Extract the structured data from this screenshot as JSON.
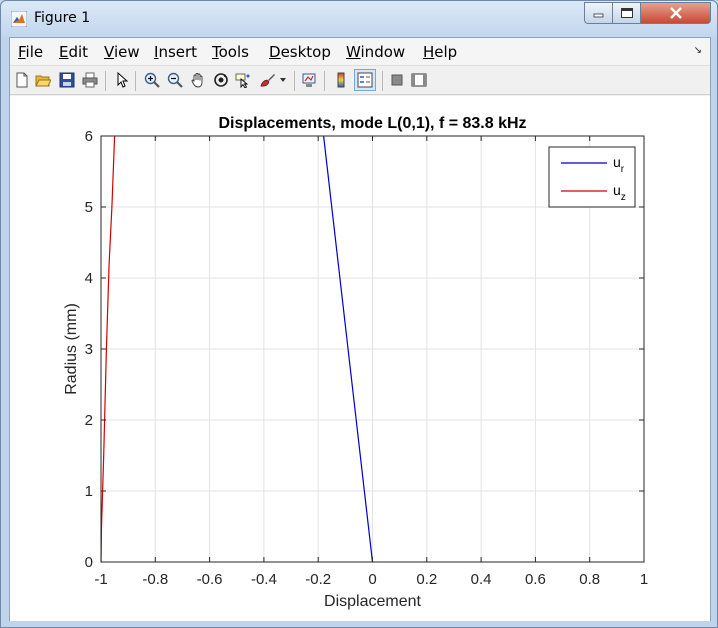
{
  "window": {
    "title": "Figure 1"
  },
  "menu": {
    "items": [
      "File",
      "Edit",
      "View",
      "Insert",
      "Tools",
      "Desktop",
      "Window",
      "Help"
    ]
  },
  "toolbar": {
    "icons": [
      "new-figure-icon",
      "open-file-icon",
      "save-icon",
      "print-icon",
      "select-arrow-icon",
      "zoom-in-icon",
      "zoom-out-icon",
      "pan-hand-icon",
      "rotate-3d-icon",
      "data-cursor-icon",
      "brush-icon",
      "link-plot-icon",
      "colorbar-icon",
      "legend-icon",
      "hide-plot-tools-icon",
      "show-plot-tools-icon"
    ]
  },
  "colors": {
    "ur": "#0000c8",
    "uz": "#d40000",
    "grid": "#e3e3e3",
    "axis": "#262626"
  },
  "chart_data": {
    "type": "line",
    "title": "Displacements, mode L(0,1), f = 83.8 kHz",
    "xlabel": "Displacement",
    "ylabel": "Radius (mm)",
    "xlim": [
      -1,
      1
    ],
    "ylim": [
      0,
      6
    ],
    "xticks": [
      -1,
      -0.8,
      -0.6,
      -0.4,
      -0.2,
      0,
      0.2,
      0.4,
      0.6,
      0.8,
      1
    ],
    "xtick_labels": [
      "-1",
      "-0.8",
      "-0.6",
      "-0.4",
      "-0.2",
      "0",
      "0.2",
      "0.4",
      "0.6",
      "0.8",
      "1"
    ],
    "yticks": [
      0,
      1,
      2,
      3,
      4,
      5,
      6
    ],
    "ytick_labels": [
      "0",
      "1",
      "2",
      "3",
      "4",
      "5",
      "6"
    ],
    "grid": true,
    "legend": "top-right",
    "series": [
      {
        "name": "u",
        "subscript": "r",
        "color_key": "ur",
        "points": [
          [
            0,
            0
          ],
          [
            -0.18,
            6
          ]
        ]
      },
      {
        "name": "u",
        "subscript": "z",
        "color_key": "uz",
        "points": [
          [
            -1,
            0
          ],
          [
            -0.998,
            0.5
          ],
          [
            -0.99,
            1.5
          ],
          [
            -0.98,
            3
          ],
          [
            -0.97,
            4.2
          ],
          [
            -0.96,
            5
          ],
          [
            -0.95,
            6
          ]
        ]
      }
    ]
  }
}
